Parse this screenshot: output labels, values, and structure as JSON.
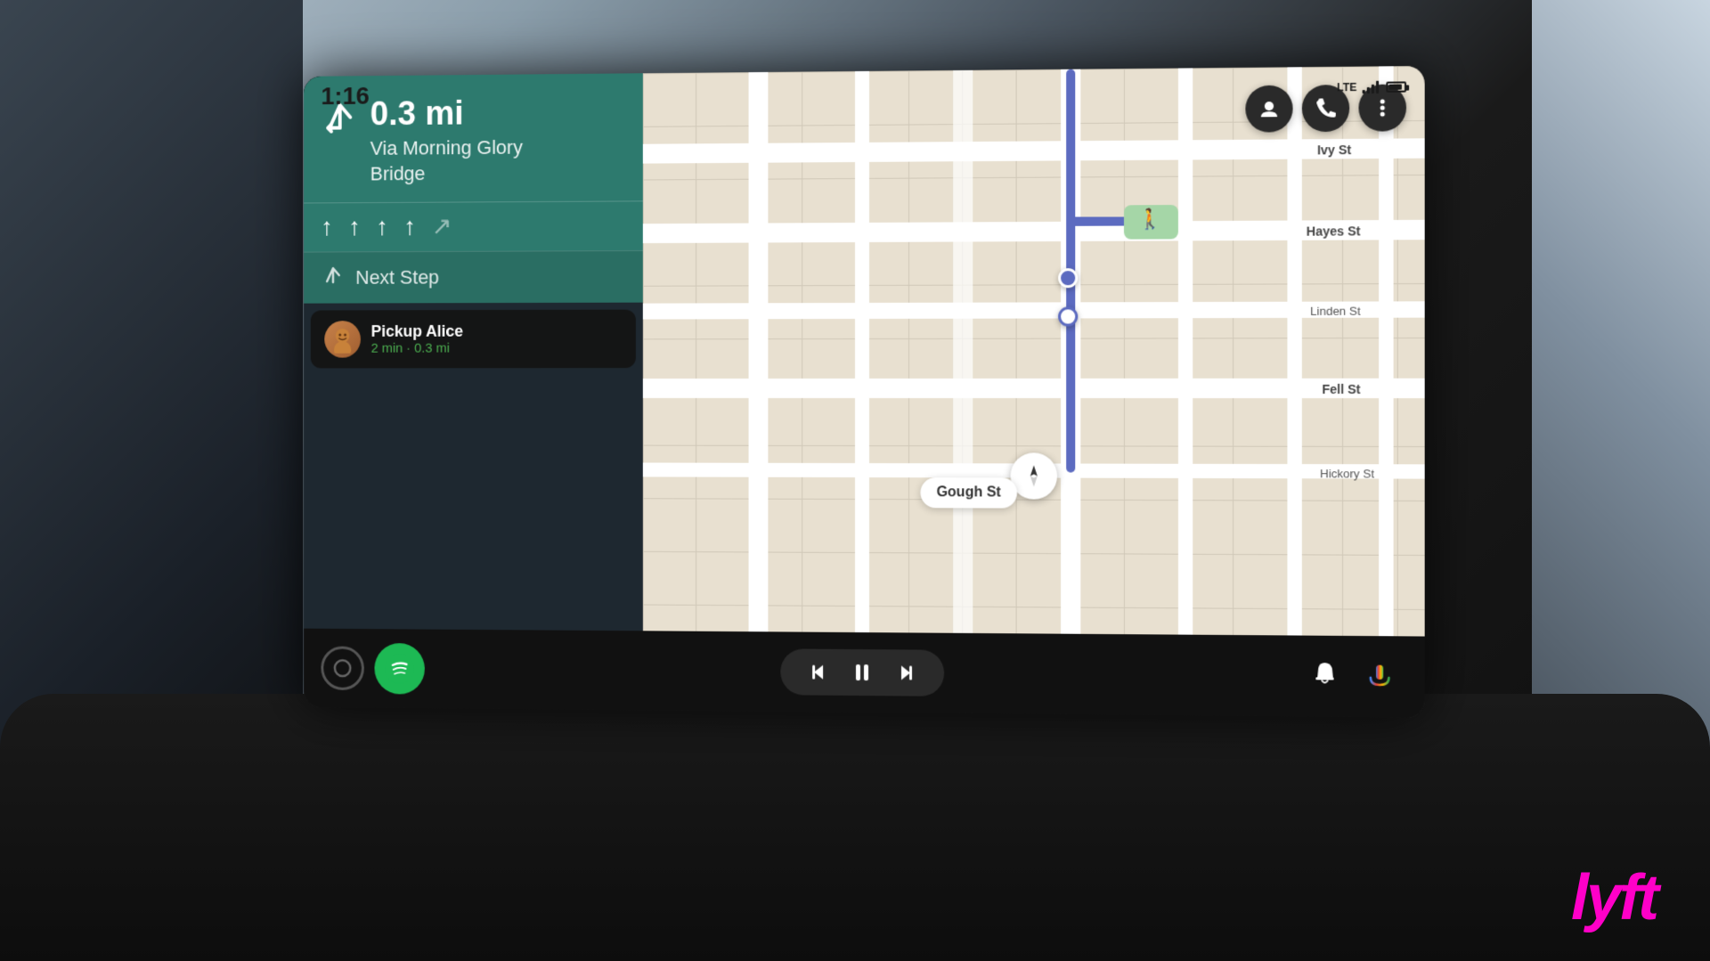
{
  "status_bar": {
    "time": "1:16",
    "lte_label": "LTE",
    "signal_bars": [
      4,
      7,
      10,
      13
    ],
    "battery_pct": 75
  },
  "navigation": {
    "distance": "0.3 mi",
    "via_label": "Via Morning Glory\nBridge",
    "turn_arrow": "↗",
    "lane_arrows": [
      "↑",
      "↑",
      "↑",
      "↑",
      "↗"
    ],
    "next_step_label": "Next Step",
    "next_step_arrow": "↗"
  },
  "pickup": {
    "name": "Pickup Alice",
    "details": "2 min · 0.3 mi"
  },
  "map": {
    "streets": [
      "Ivy St",
      "Hayes St",
      "Linden St",
      "Fell St",
      "Hickory St",
      "Gough St"
    ],
    "current_street": "Gough St"
  },
  "media": {
    "prev_label": "⏮",
    "pause_label": "⏸",
    "next_label": "⏭"
  },
  "buttons": {
    "contact_icon": "👤",
    "phone_icon": "📞",
    "more_icon": "⋮",
    "notification_icon": "🔔",
    "mic_icon": "🎤"
  },
  "lyft": {
    "logo": "lyft"
  }
}
